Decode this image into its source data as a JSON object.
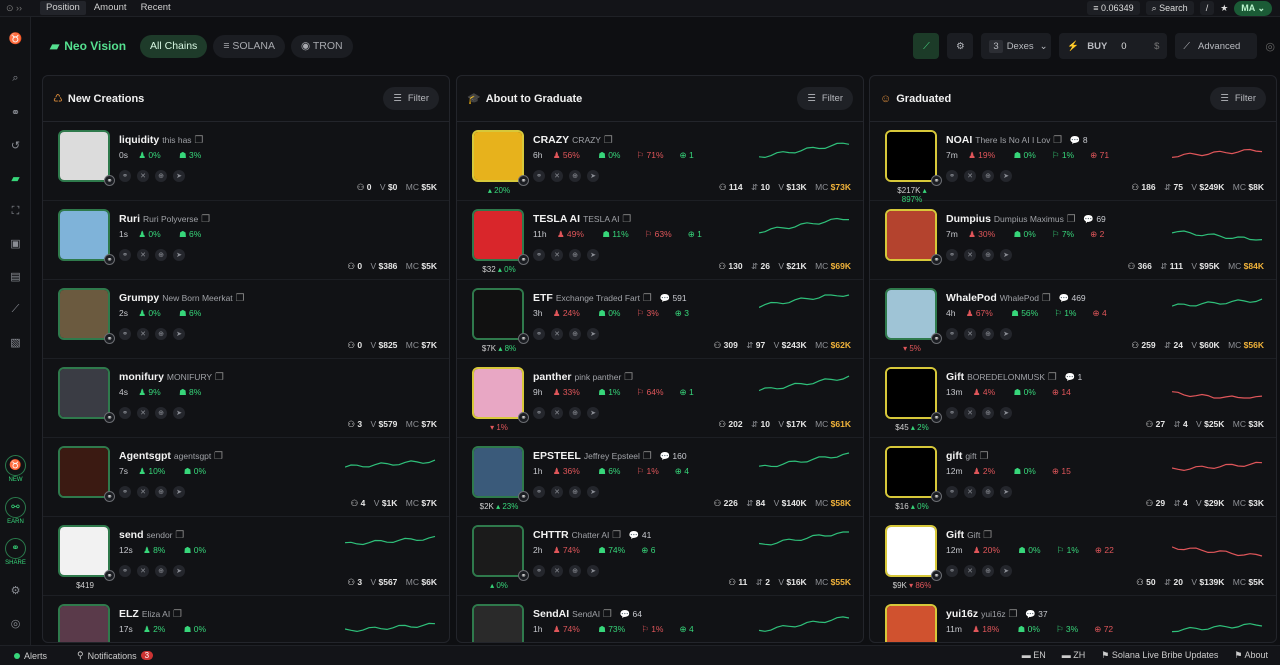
{
  "topbar": {
    "tabs": [
      "Position",
      "Amount",
      "Recent"
    ],
    "price": "0.06349",
    "search": "Search",
    "search_key": "/",
    "user": "MA"
  },
  "header": {
    "brand": "Neo Vision",
    "chips": [
      "All Chains",
      "SOLANA",
      "TRON"
    ],
    "dex_count": "3",
    "dex_label": "Dexes",
    "buy_label": "BUY",
    "buy_amount": "0",
    "buy_unit": "$",
    "advanced": "Advanced"
  },
  "sidebar": {
    "badges": [
      "NEW",
      "EARN",
      "SHARE"
    ]
  },
  "columns": [
    {
      "title": "New Creations",
      "filter": "Filter",
      "rows": [
        {
          "ticker": "liquidity",
          "name": "this has",
          "age": "0s",
          "s1": "0%",
          "s2": "3%",
          "holders": "0",
          "vol": "$0",
          "mc": "$5K",
          "sub": "",
          "chg": "",
          "color": "#dcdcdc"
        },
        {
          "ticker": "Ruri",
          "name": "Ruri Polyverse",
          "age": "1s",
          "s1": "0%",
          "s2": "6%",
          "holders": "0",
          "vol": "$386",
          "mc": "$5K",
          "sub": "",
          "chg": "",
          "color": "#7fb3d9"
        },
        {
          "ticker": "Grumpy",
          "name": "New Born Meerkat",
          "age": "2s",
          "s1": "0%",
          "s2": "6%",
          "holders": "0",
          "vol": "$825",
          "mc": "$7K",
          "sub": "",
          "chg": "",
          "color": "#6b5a3f"
        },
        {
          "ticker": "monifury",
          "name": "MONIFURY",
          "age": "4s",
          "s1": "9%",
          "s2": "8%",
          "holders": "3",
          "vol": "$579",
          "mc": "$7K",
          "sub": "",
          "chg": "",
          "color": "#3a3c44"
        },
        {
          "ticker": "Agentsgpt",
          "name": "agentsgpt",
          "age": "7s",
          "s1": "10%",
          "s2": "0%",
          "holders": "4",
          "vol": "$1K",
          "mc": "$7K",
          "sub": "",
          "chg": "",
          "color": "#3b1a12"
        },
        {
          "ticker": "send",
          "name": "sendor",
          "age": "12s",
          "s1": "8%",
          "s2": "0%",
          "holders": "3",
          "vol": "$567",
          "mc": "$6K",
          "sub": "$419",
          "chg": "",
          "color": "#f2f2f2"
        },
        {
          "ticker": "ELZ",
          "name": "Eliza AI",
          "age": "17s",
          "s1": "2%",
          "s2": "0%",
          "holders": "",
          "vol": "",
          "mc": "",
          "sub": "",
          "chg": "",
          "color": "#5a3a4a"
        }
      ]
    },
    {
      "title": "About to Graduate",
      "filter": "Filter",
      "rows": [
        {
          "ticker": "CRAZY",
          "name": "CRAZY",
          "age": "6h",
          "s1": "56%",
          "s2": "0%",
          "s3": "71%",
          "s4": "1",
          "holders": "114",
          "hc": "10",
          "vol": "$13K",
          "mc": "$73K",
          "sub": "",
          "chg": "20%",
          "color": "#e7b21c"
        },
        {
          "ticker": "TESLA AI",
          "name": "TESLA AI",
          "age": "11h",
          "s1": "49%",
          "s2": "11%",
          "s3": "63%",
          "s4": "1",
          "holders": "130",
          "hc": "26",
          "vol": "$21K",
          "mc": "$69K",
          "sub": "$32",
          "chg": "0%",
          "color": "#d9262b"
        },
        {
          "ticker": "ETF",
          "name": "Exchange Traded Fart",
          "comments": "591",
          "age": "3h",
          "s1": "24%",
          "s2": "0%",
          "s3": "3%",
          "s4": "3",
          "holders": "309",
          "hc": "97",
          "vol": "$243K",
          "mc": "$62K",
          "sub": "$7K",
          "chg": "8%",
          "color": "#111"
        },
        {
          "ticker": "panther",
          "name": "pink panther",
          "age": "9h",
          "s1": "33%",
          "s2": "1%",
          "s3": "64%",
          "s4": "1",
          "holders": "202",
          "hc": "10",
          "vol": "$17K",
          "mc": "$61K",
          "sub": "",
          "chg": "1%",
          "color": "#e8a7c4"
        },
        {
          "ticker": "EPSTEEL",
          "name": "Jeffrey Epsteel",
          "comments": "160",
          "age": "1h",
          "s1": "36%",
          "s2": "6%",
          "s3": "1%",
          "s4": "4",
          "holders": "226",
          "hc": "84",
          "vol": "$140K",
          "mc": "$58K",
          "sub": "$2K",
          "chg": "23%",
          "color": "#3a5a7a"
        },
        {
          "ticker": "CHTTR",
          "name": "Chatter AI",
          "comments": "41",
          "age": "2h",
          "s1": "74%",
          "s2": "74%",
          "s3": "",
          "s4": "6",
          "holders": "11",
          "hc": "2",
          "vol": "$16K",
          "mc": "$55K",
          "sub": "",
          "chg": "0%",
          "color": "#1b1b1b"
        },
        {
          "ticker": "SendAI",
          "name": "SendAI",
          "comments": "64",
          "age": "1h",
          "s1": "74%",
          "s2": "73%",
          "s3": "1%",
          "s4": "4",
          "holders": "",
          "hc": "",
          "vol": "",
          "mc": "",
          "sub": "",
          "chg": "",
          "color": "#2a2a2a"
        }
      ]
    },
    {
      "title": "Graduated",
      "filter": "Filter",
      "rows": [
        {
          "ticker": "NOAI",
          "name": "There Is No AI I Lov",
          "comments": "8",
          "age": "7m",
          "s1": "19%",
          "s2": "0%",
          "s3": "1%",
          "s4": "71",
          "holders": "186",
          "hc": "75",
          "vol": "$249K",
          "mc": "$8K",
          "sub": "$217K",
          "chg": "897%",
          "color": "#000"
        },
        {
          "ticker": "Dumpius",
          "name": "Dumpius Maximus",
          "comments": "69",
          "age": "7m",
          "s1": "30%",
          "s2": "0%",
          "s3": "7%",
          "s4": "2",
          "holders": "366",
          "hc": "111",
          "vol": "$95K",
          "mc": "$84K",
          "sub": "",
          "chg": "",
          "color": "#b4432e"
        },
        {
          "ticker": "WhalePod",
          "name": "WhalePod",
          "comments": "469",
          "age": "4h",
          "s1": "67%",
          "s2": "56%",
          "s3": "1%",
          "s4": "4",
          "holders": "259",
          "hc": "24",
          "vol": "$60K",
          "mc": "$56K",
          "sub": "",
          "chg": "5%",
          "color": "#9fc4d6"
        },
        {
          "ticker": "Gift",
          "name": "BOREDELONMUSK",
          "comments": "1",
          "age": "13m",
          "s1": "4%",
          "s2": "0%",
          "s3": "",
          "s4": "14",
          "holders": "27",
          "hc": "4",
          "vol": "$25K",
          "mc": "$3K",
          "sub": "$45",
          "chg": "2%",
          "color": "#000"
        },
        {
          "ticker": "gift",
          "name": "gift",
          "age": "12m",
          "s1": "2%",
          "s2": "0%",
          "s3": "",
          "s4": "15",
          "holders": "29",
          "hc": "4",
          "vol": "$29K",
          "mc": "$3K",
          "sub": "$16",
          "chg": "0%",
          "color": "#000"
        },
        {
          "ticker": "Gift",
          "name": "Gift",
          "age": "12m",
          "s1": "20%",
          "s2": "0%",
          "s3": "1%",
          "s4": "22",
          "holders": "50",
          "hc": "20",
          "vol": "$139K",
          "mc": "$5K",
          "sub": "$9K",
          "chg": "86%",
          "color": "#fff"
        },
        {
          "ticker": "yui16z",
          "name": "yui16z",
          "comments": "37",
          "age": "11m",
          "s1": "18%",
          "s2": "0%",
          "s3": "3%",
          "s4": "72",
          "holders": "",
          "hc": "",
          "vol": "",
          "mc": "",
          "sub": "",
          "chg": "",
          "color": "#d0522f"
        }
      ]
    }
  ],
  "bottombar": {
    "alerts": "Alerts",
    "notifications": "Notifications",
    "notif_count": "3",
    "lang1": "EN",
    "lang2": "ZH",
    "bribe": "Solana Live Bribe Updates",
    "about": "About"
  }
}
